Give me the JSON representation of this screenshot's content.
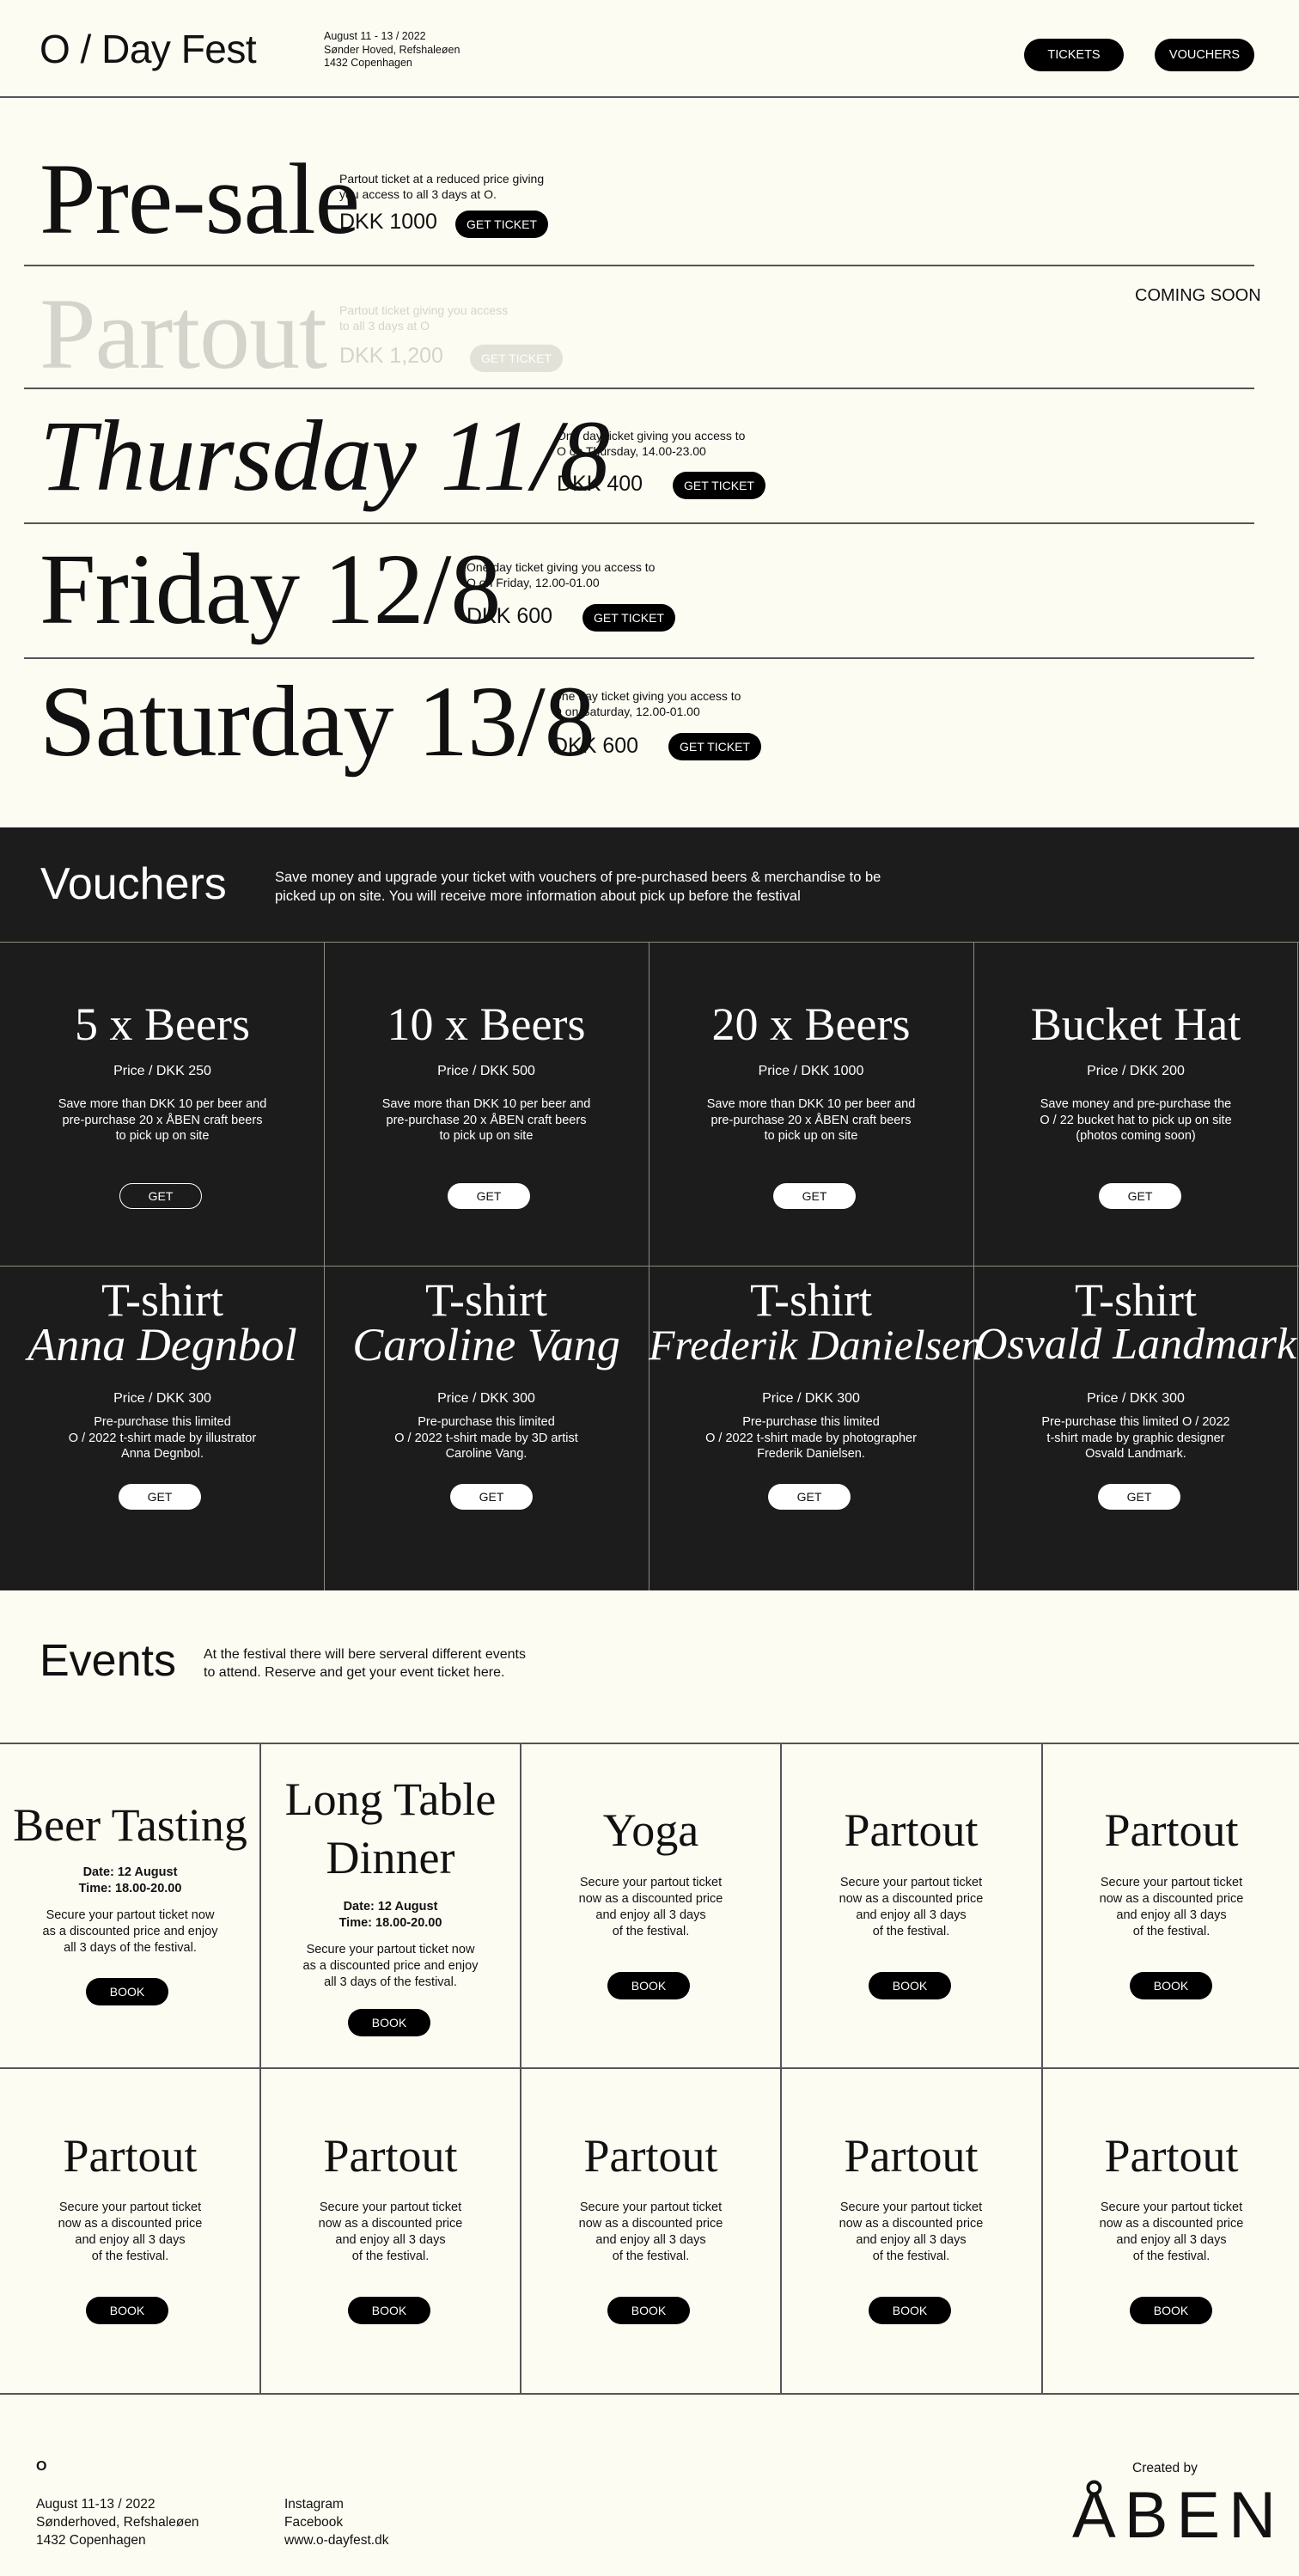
{
  "header": {
    "logo": "O / Day Fest",
    "info": [
      "August 11 - 13 / 2022",
      "Sønder Hoved, Refshaleøen",
      "1432 Copenhagen"
    ],
    "tickets_button": "TICKETS",
    "vouchers_button": "VOUCHERS"
  },
  "tickets": {
    "presale": {
      "title": "Pre-sale",
      "desc": [
        "Partout ticket at a reduced price giving",
        "you access to all 3 days at O."
      ],
      "price": "DKK 1000",
      "button": "GET TICKET"
    },
    "partout": {
      "title": "Partout",
      "desc": [
        "Partout ticket giving you access",
        "to all 3 days at O"
      ],
      "price": "DKK 1,200",
      "button": "GET TICKET",
      "status": "COMING SOON"
    },
    "thursday": {
      "title": "Thursday 11/8",
      "desc": [
        "One day ticket giving you access to",
        "O on Thursday, 14.00-23.00"
      ],
      "price": "DKK 400",
      "button": "GET TICKET"
    },
    "friday": {
      "title": "Friday 12/8",
      "desc": [
        "One day ticket giving you access to",
        "O on Friday, 12.00-01.00"
      ],
      "price": "DKK 600",
      "button": "GET TICKET"
    },
    "saturday": {
      "title": "Saturday 13/8",
      "desc": [
        "One day ticket giving you access to",
        "O on Saturday, 12.00-01.00"
      ],
      "price": "DKK 600",
      "button": "GET TICKET"
    }
  },
  "vouchers": {
    "title": "Vouchers",
    "intro": [
      "Save money and upgrade your ticket with vouchers of pre-purchased beers & merchandise to be",
      "picked up on site. You will receive more information about pick up before the festival"
    ],
    "cards": [
      {
        "title": "5 x Beers",
        "price": "Price / DKK 250",
        "desc": [
          "Save more than DKK 10 per beer and",
          "pre-purchase 20 x ÅBEN craft beers",
          "to pick up on site"
        ],
        "button": "GET"
      },
      {
        "title": "10 x Beers",
        "price": "Price / DKK 500",
        "desc": [
          "Save more than DKK 10 per beer and",
          "pre-purchase 20 x ÅBEN craft beers",
          "to pick up on site"
        ],
        "button": "GET"
      },
      {
        "title": "20 x Beers",
        "price": "Price / DKK 1000",
        "desc": [
          "Save more than DKK 10 per beer and",
          "pre-purchase 20 x ÅBEN craft beers",
          "to pick up on site"
        ],
        "button": "GET"
      },
      {
        "title": "Bucket Hat",
        "price": "Price / DKK 200",
        "desc": [
          "Save money and pre-purchase the",
          "O / 22 bucket hat to pick up on site",
          "(photos coming soon)"
        ],
        "button": "GET"
      },
      {
        "title": "T-shirt",
        "subtitle": "Anna Degnbol",
        "price": "Price / DKK 300",
        "desc": [
          "Pre-purchase this limited",
          "O / 2022 t-shirt made by illustrator",
          "Anna Degnbol."
        ],
        "button": "GET"
      },
      {
        "title": "T-shirt",
        "subtitle": "Caroline Vang",
        "price": "Price / DKK 300",
        "desc": [
          "Pre-purchase this limited",
          "O / 2022 t-shirt made by 3D artist",
          "Caroline Vang."
        ],
        "button": "GET"
      },
      {
        "title": "T-shirt",
        "subtitle": "Frederik Danielsen",
        "price": "Price / DKK 300",
        "desc": [
          "Pre-purchase this limited",
          "O / 2022 t-shirt made by photographer",
          "Frederik Danielsen."
        ],
        "button": "GET"
      },
      {
        "title": "T-shirt",
        "subtitle": "Osvald Landmark",
        "price": "Price / DKK 300",
        "desc": [
          "Pre-purchase this limited O / 2022",
          "t-shirt made by graphic designer",
          "Osvald Landmark."
        ],
        "button": "GET"
      }
    ]
  },
  "events": {
    "title": "Events",
    "intro": [
      "At the festival there will bere serveral different events",
      "to attend. Reserve and get your event ticket here."
    ],
    "cards": [
      {
        "title": "Beer Tasting",
        "date": [
          "Date: 12 August",
          "Time: 18.00-20.00"
        ],
        "desc": [
          "Secure your partout ticket now",
          "as a discounted price and enjoy",
          "all 3 days of the festival."
        ],
        "button": "BOOK"
      },
      {
        "title": "Long Table Dinner",
        "date": [
          "Date: 12 August",
          "Time: 18.00-20.00"
        ],
        "desc": [
          "Secure your partout ticket now",
          "as a discounted price and enjoy",
          "all 3 days of the festival."
        ],
        "button": "BOOK"
      },
      {
        "title": "Yoga",
        "desc": [
          "Secure your partout ticket",
          "now as a discounted price",
          "and enjoy all 3 days",
          "of the festival."
        ],
        "button": "BOOK"
      },
      {
        "title": "Partout",
        "desc": [
          "Secure your partout ticket",
          "now as a discounted price",
          "and enjoy all 3 days",
          "of the festival."
        ],
        "button": "BOOK"
      },
      {
        "title": "Partout",
        "desc": [
          "Secure your partout ticket",
          "now as a discounted price",
          "and enjoy all 3 days",
          "of the festival."
        ],
        "button": "BOOK"
      },
      {
        "title": "Partout",
        "desc": [
          "Secure your partout ticket",
          "now as a discounted price",
          "and enjoy all 3 days",
          "of the festival."
        ],
        "button": "BOOK"
      },
      {
        "title": "Partout",
        "desc": [
          "Secure your partout ticket",
          "now as a discounted price",
          "and enjoy all 3 days",
          "of the festival."
        ],
        "button": "BOOK"
      },
      {
        "title": "Partout",
        "desc": [
          "Secure your partout ticket",
          "now as a discounted price",
          "and enjoy all 3 days",
          "of the festival."
        ],
        "button": "BOOK"
      },
      {
        "title": "Partout",
        "desc": [
          "Secure your partout ticket",
          "now as a discounted price",
          "and enjoy all 3 days",
          "of the festival."
        ],
        "button": "BOOK"
      },
      {
        "title": "Partout",
        "desc": [
          "Secure your partout ticket",
          "now as a discounted price",
          "and enjoy all 3 days",
          "of the festival."
        ],
        "button": "BOOK"
      }
    ]
  },
  "footer": {
    "logo": "O",
    "address": [
      "August 11-13 / 2022",
      "Sønderhoved, Refshaleøen",
      "1432 Copenhagen"
    ],
    "links": [
      "Instagram",
      "Facebook",
      "www.o-dayfest.dk"
    ],
    "created_by": "Created by",
    "brand": "ÅBEN"
  }
}
